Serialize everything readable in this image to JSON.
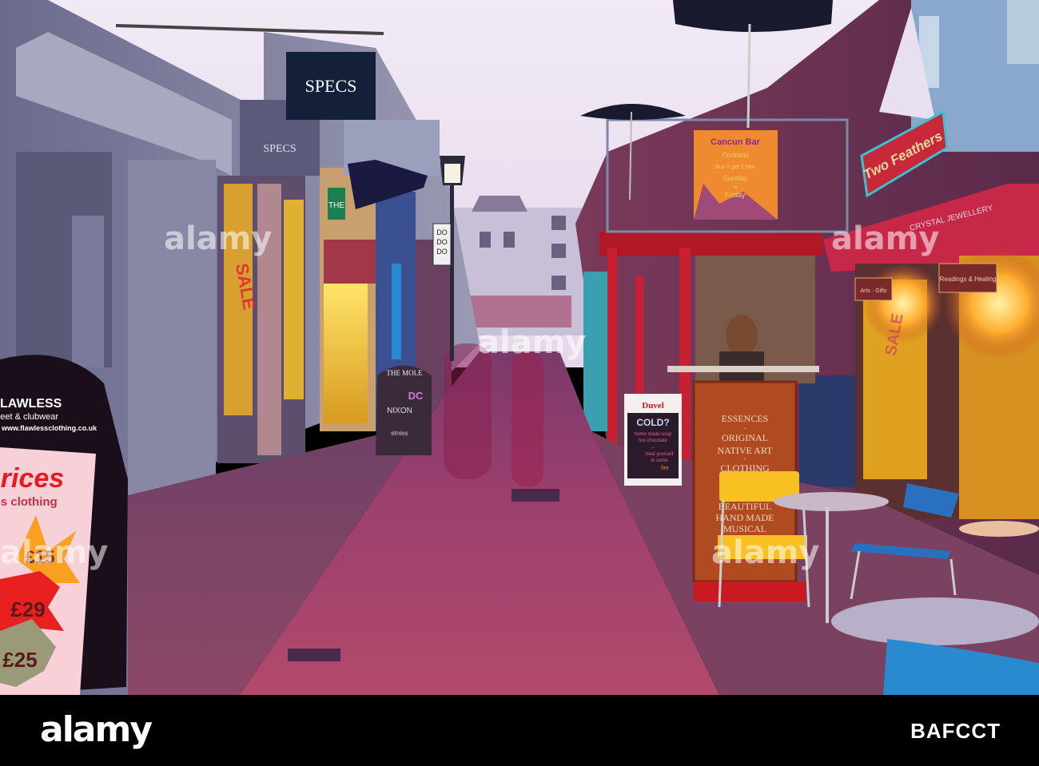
{
  "signs": {
    "specs": "SPECS",
    "specs_shopfront": "SPECS",
    "the_mole": "THE MOLE",
    "nixon": "NIXON",
    "etnies": "etnies",
    "dc": "DC",
    "dodo": [
      "DO",
      "DO",
      "DO"
    ],
    "the_shop": "THE",
    "cancun": {
      "title": "Cancun Bar",
      "lines": [
        "Cocktails",
        "Buy 2 get 1 free",
        "Sunday",
        "to",
        "Friday"
      ]
    },
    "two_feathers": "Two Feathers",
    "crystal": "CRYSTAL JEWELLERY",
    "readings": "Readings & Healing",
    "arts": "Arts · Gifts",
    "sale": "SALE",
    "essences": [
      "ESSENCES",
      "·",
      "ORIGINAL",
      "NATIVE ART",
      "·",
      "CLOTHING",
      "·",
      "BEAUTIFUL",
      "HAND MADE",
      "MUSICAL"
    ],
    "duvel": {
      "brand": "Duvel",
      "title": "COLD?",
      "lines": [
        "home made soup",
        "hot chocolate",
        "...",
        "treat yourself",
        "to some",
        "fire"
      ]
    },
    "lawless": {
      "brand": "LAWLESS",
      "tagline": "street & clubwear",
      "url": "www.flawlessclothing.co.uk",
      "headline": "prices",
      "sub": "less clothing",
      "price1": "£15",
      "price2": "£29",
      "price3": "£25"
    }
  },
  "watermark": {
    "logo": "alamy",
    "image_id": "BAFCCT"
  },
  "colors": {
    "sky": "#efe6f3",
    "street": "#a8456f",
    "neon_red": "#d8203a",
    "lamp_glow": "#ffcf4a"
  }
}
